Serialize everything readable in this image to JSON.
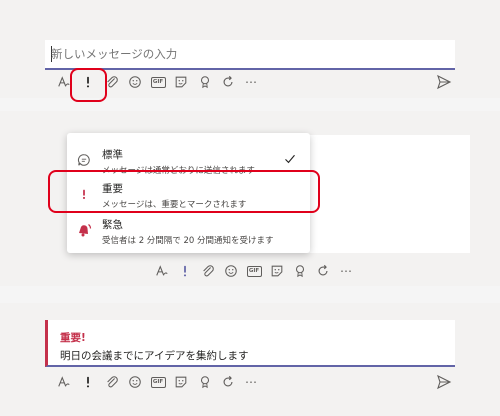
{
  "compose": {
    "placeholder": "新しいメッセージの入力"
  },
  "icons": {
    "format": "format-icon",
    "important": "exclamation-icon",
    "attach": "paperclip-icon",
    "emoji": "emoji-icon",
    "gif": "GIF",
    "sticker": "sticker-icon",
    "praise": "praise-icon",
    "loop": "loop-icon",
    "more": "⋯",
    "send": "send-icon"
  },
  "delivery_menu": {
    "items": [
      {
        "title": "標準",
        "description": "メッセージは通常どおりに送信されます",
        "selected": true
      },
      {
        "title": "重要",
        "description": "メッセージは、重要とマークされます",
        "selected": false
      },
      {
        "title": "緊急",
        "description": "受信者は 2 分間隔で 20 分間通知を受けます",
        "selected": false
      }
    ]
  },
  "message": {
    "label": "重要!",
    "text": "明日の会議までにアイデアを集約します"
  },
  "colors": {
    "accent": "#6264a7",
    "important": "#c4314b",
    "highlight": "#e0001b"
  }
}
